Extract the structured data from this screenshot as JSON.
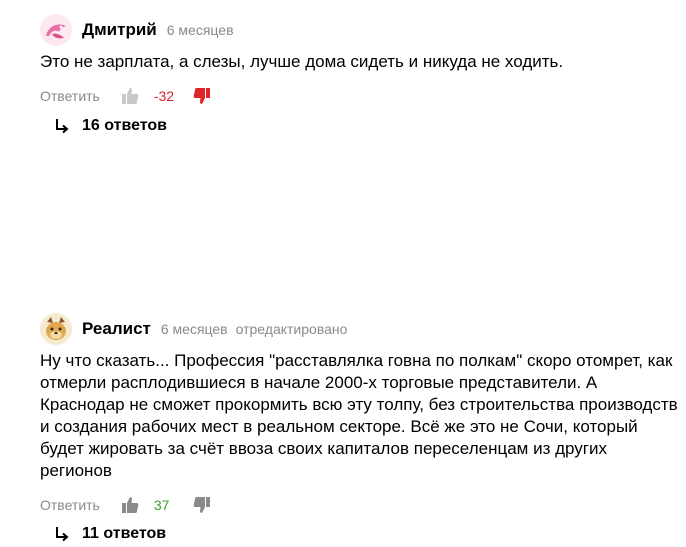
{
  "comments": [
    {
      "author": "Дмитрий",
      "time": "6 месяцев",
      "edited": "",
      "text": "Это не зарплата, а слезы, лучше дома сидеть и никуда не ходить.",
      "reply_label": "Ответить",
      "score": "-32",
      "replies_label": "16 ответов",
      "avatar_color": "#e86fa4"
    },
    {
      "author": "Реалист",
      "time": "6 месяцев",
      "edited": "отредактировано",
      "text": "Ну что сказать... Профессия \"расставлялка говна по полкам\" скоро отомрет, как отмерли расплодившиеся в начале 2000-х торговые представители. А Краснодар не сможет прокормить всю эту толпу, без строительства производств и создания рабочих мест в реальном секторе. Всё же это не Сочи, который будет жировать за счёт ввоза своих капиталов переселенцам из других регионов",
      "reply_label": "Ответить",
      "score": "37",
      "replies_label": "11 ответов",
      "avatar_color": "#e9cf93"
    }
  ],
  "colors": {
    "muted": "#8a8a8a",
    "negative": "#e0242a",
    "positive": "#3ba52d"
  },
  "icons": [
    "thumb-up-icon",
    "thumb-down-icon",
    "reply-arrow-icon",
    "avatar"
  ]
}
